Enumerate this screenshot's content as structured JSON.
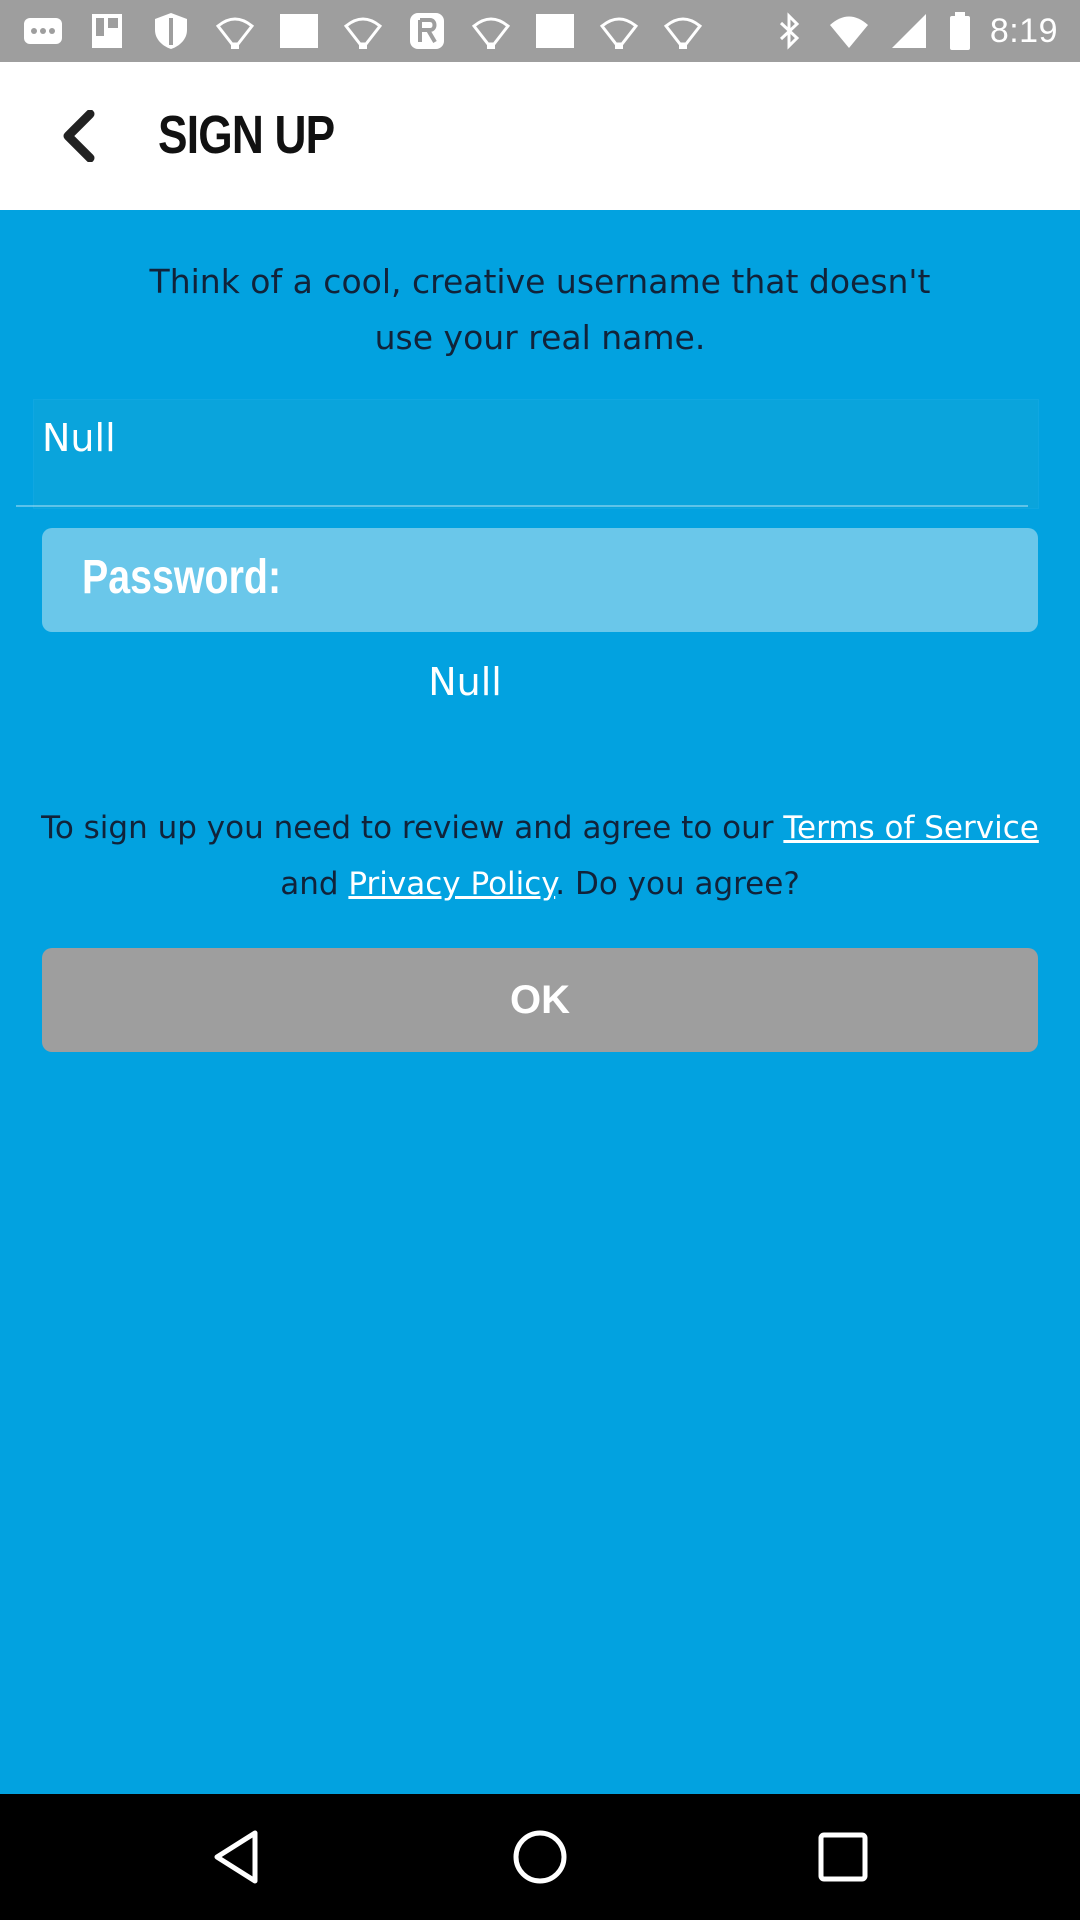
{
  "status_bar": {
    "time": "8:19",
    "left_icons": [
      "more-icon",
      "tray-icon",
      "shield-icon",
      "bulb-icon",
      "square-icon",
      "bulb-icon",
      "r-badge-icon",
      "bulb-icon",
      "square-icon",
      "bulb-icon",
      "bulb-icon"
    ],
    "right_icons": [
      "bluetooth-icon",
      "wifi-icon",
      "signal-icon",
      "battery-icon"
    ]
  },
  "header": {
    "title": "SIGN UP",
    "back_icon": "chevron-left-icon"
  },
  "main": {
    "instructions": "Think of a cool, creative username that doesn't use your real name.",
    "username_field": {
      "value": "Null"
    },
    "password_label": "Password:",
    "password_value": "Null",
    "terms": {
      "prefix": "To sign up you need to review and agree to our ",
      "terms_link": "Terms of Service",
      "middle": " and ",
      "privacy_link": "Privacy Policy",
      "suffix": ". Do you agree?"
    },
    "ok_label": "OK"
  },
  "nav_bar": {
    "icons": [
      "back-triangle-icon",
      "home-circle-icon",
      "recents-square-icon"
    ]
  },
  "colors": {
    "background": "#02a2e0",
    "app_bar": "#ffffff",
    "password_box": "#6ac7ea",
    "ok_button": "#9e9e9e",
    "status_bar": "#9e9e9e"
  }
}
